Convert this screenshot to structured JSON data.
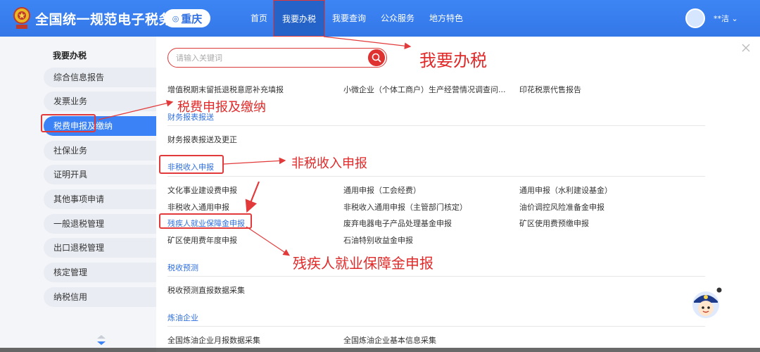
{
  "header": {
    "site_title": "全国统一规范电子税务局",
    "region": "重庆",
    "nav": [
      {
        "label": "首页"
      },
      {
        "label": "我要办税"
      },
      {
        "label": "我要查询"
      },
      {
        "label": "公众服务"
      },
      {
        "label": "地方特色"
      }
    ],
    "user": "**洁 ⌄"
  },
  "sidebar": {
    "title": "我要办税",
    "items": [
      {
        "label": "综合信息报告"
      },
      {
        "label": "发票业务"
      },
      {
        "label": "税费申报及缴纳"
      },
      {
        "label": "社保业务"
      },
      {
        "label": "证明开具"
      },
      {
        "label": "其他事项申请"
      },
      {
        "label": "一般退税管理"
      },
      {
        "label": "出口退税管理"
      },
      {
        "label": "核定管理"
      },
      {
        "label": "纳税信用"
      }
    ]
  },
  "search": {
    "placeholder": "请输入关键词"
  },
  "content": {
    "top_row": [
      "增值税期末留抵退税意愿补充填报",
      "小微企业（个体工商户）生产经营情况调查问...",
      "印花税票代售报告"
    ],
    "sections": [
      {
        "title": "财务报表报送",
        "items": [
          "财务报表报送及更正"
        ]
      },
      {
        "title": "非税收入申报",
        "items": [
          "文化事业建设费申报",
          "通用申报（工会经费）",
          "通用申报（水利建设基金）",
          "非税收入通用申报",
          "非税收入通用申报（主管部门核定）",
          "油价调控风险准备金申报",
          "残疾人就业保障金申报",
          "废弃电器电子产品处理基金申报",
          "矿区使用费预缴申报",
          "矿区使用费年度申报",
          "石油特别收益金申报"
        ]
      },
      {
        "title": "税收预测",
        "items": [
          "税收预测直报数据采集"
        ]
      },
      {
        "title": "炼油企业",
        "items": [
          "全国炼油企业月报数据采集",
          "全国炼油企业基本信息采集"
        ]
      }
    ]
  },
  "annotations": {
    "nav_note": "我要办税",
    "sidebar_note": "税费申报及缴纳",
    "section_note": "非税收入申报",
    "item_note": "残疾人就业保障金申报"
  },
  "colors": {
    "header_blue": "#3b82f6",
    "accent_red": "#e23a3a",
    "link_blue": "#2f6fe0"
  }
}
